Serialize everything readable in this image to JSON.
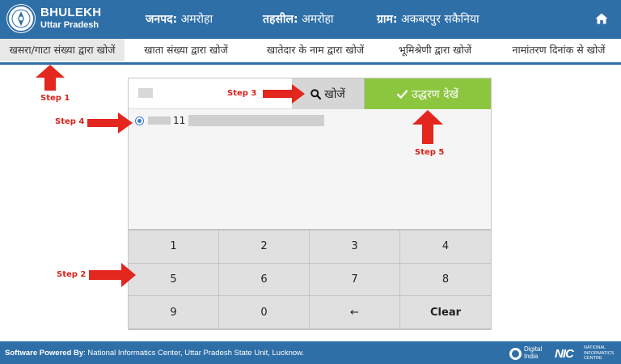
{
  "header": {
    "brand_title": "BHULEKH",
    "brand_subtitle": "Uttar Pradesh",
    "district_label": "जनपद:",
    "district_value": "अमरोहा",
    "tehsil_label": "तहसील:",
    "tehsil_value": "अमरोहा",
    "village_label": "ग्राम:",
    "village_value": "अकबरपुर सकैनिया",
    "home_icon": "home-icon"
  },
  "tabs": [
    {
      "label": "खसरा/गाटा संख्या द्वारा खोजें",
      "active": true
    },
    {
      "label": "खाता संख्या द्वारा खोजें",
      "active": false
    },
    {
      "label": "खातेदार के नाम द्वारा खोजें",
      "active": false
    },
    {
      "label": "भूमिश्रेणी द्वारा खोजें",
      "active": false
    },
    {
      "label": "नामांतरण दिनांक से खोजें",
      "active": false
    }
  ],
  "search": {
    "input_value": "",
    "search_label": "खोजें",
    "search_icon": "search-icon",
    "view_label": "उद्धरण देखें",
    "view_icon": "check-icon"
  },
  "results": [
    {
      "value": "11",
      "selected": true
    }
  ],
  "keypad": [
    [
      "1",
      "2",
      "3",
      "4"
    ],
    [
      "5",
      "6",
      "7",
      "8"
    ],
    [
      "9",
      "0",
      "←",
      "Clear"
    ]
  ],
  "annotations": {
    "step1": "Step 1",
    "step2": "Step 2",
    "step3": "Step 3",
    "step4": "Step 4",
    "step5": "Step 5"
  },
  "footer": {
    "powered_label": "Software Powered By",
    "powered_text": ": National Informatics Center, Uttar Pradesh State Unit, Lucknow.",
    "digital_line1": "Digital",
    "digital_line2": "India",
    "nic_mark": "NIC",
    "nic_line1": "NATIONAL",
    "nic_line2": "INFORMATICS",
    "nic_line3": "CENTRE"
  },
  "colors": {
    "header_blue": "#2e6fa8",
    "view_green": "#8cc63f",
    "annotation_red": "#d9221b"
  }
}
